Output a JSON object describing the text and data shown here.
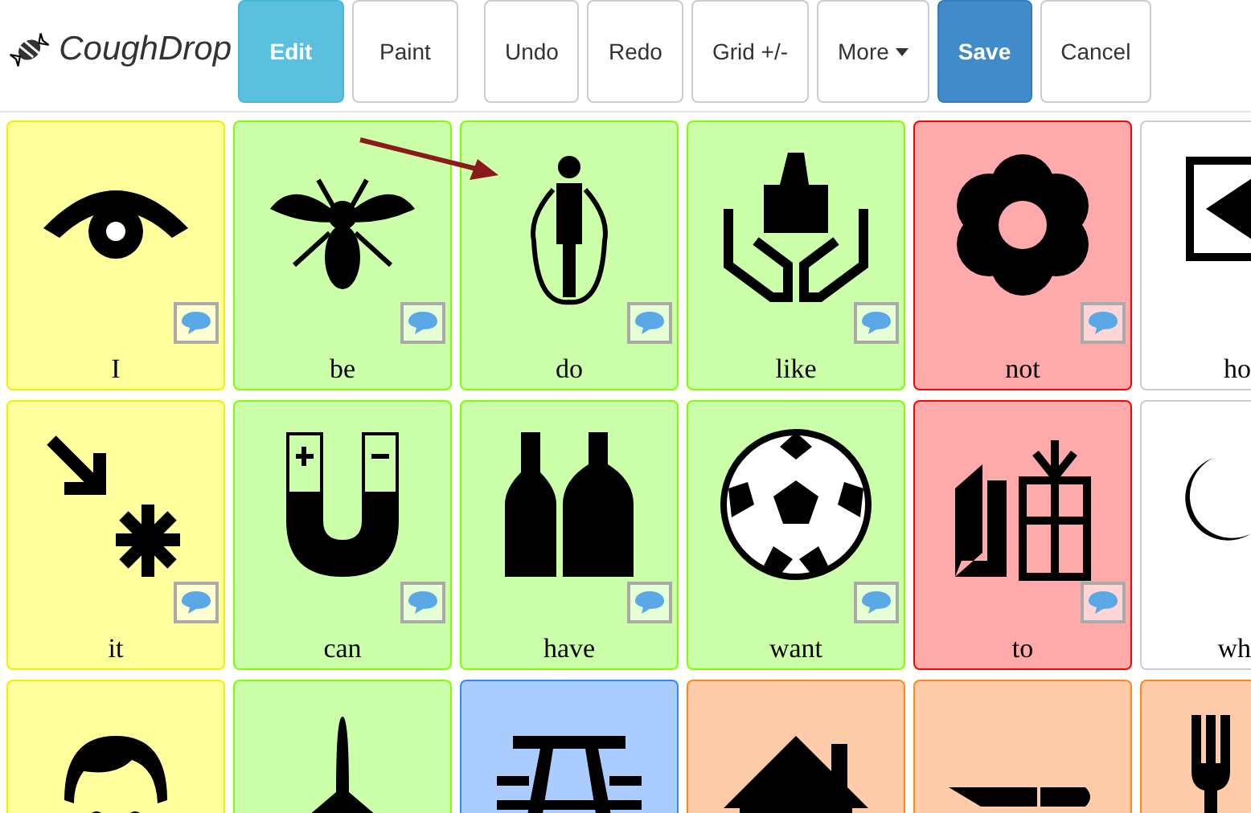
{
  "header": {
    "app_name": "CoughDrop",
    "mode_buttons": [
      {
        "label": "Edit",
        "selected": true
      },
      {
        "label": "Paint",
        "selected": false
      }
    ],
    "action_buttons": [
      {
        "label": "Undo",
        "kind": "default"
      },
      {
        "label": "Redo",
        "kind": "default"
      },
      {
        "label": "Grid +/-",
        "kind": "default"
      },
      {
        "label": "More",
        "kind": "dropdown"
      },
      {
        "label": "Save",
        "kind": "primary"
      },
      {
        "label": "Cancel",
        "kind": "default"
      }
    ]
  },
  "board": {
    "cells": [
      {
        "label": "I",
        "color": "#ffff9e",
        "sound": true
      },
      {
        "label": "be",
        "color": "#ccffaa",
        "sound": true
      },
      {
        "label": "do",
        "color": "#ccffaa",
        "sound": true
      },
      {
        "label": "like",
        "color": "#ccffaa",
        "sound": true
      },
      {
        "label": "not",
        "color": "#ffaaaa",
        "sound": true
      },
      {
        "label": "ho",
        "color": "#ffffff",
        "sound": false
      },
      {
        "label": "it",
        "color": "#ffff9e",
        "sound": true
      },
      {
        "label": "can",
        "color": "#ccffaa",
        "sound": true
      },
      {
        "label": "have",
        "color": "#ccffaa",
        "sound": true
      },
      {
        "label": "want",
        "color": "#ccffaa",
        "sound": true
      },
      {
        "label": "to",
        "color": "#ffaaaa",
        "sound": true
      },
      {
        "label": "wh",
        "color": "#ffffff",
        "sound": false
      },
      {
        "color": "#ffff9e"
      },
      {
        "color": "#ccffaa"
      },
      {
        "color": "#aaccff"
      },
      {
        "color": "#ffccaa"
      },
      {
        "color": "#ffccaa"
      },
      {
        "color": "#ffccaa"
      }
    ]
  }
}
